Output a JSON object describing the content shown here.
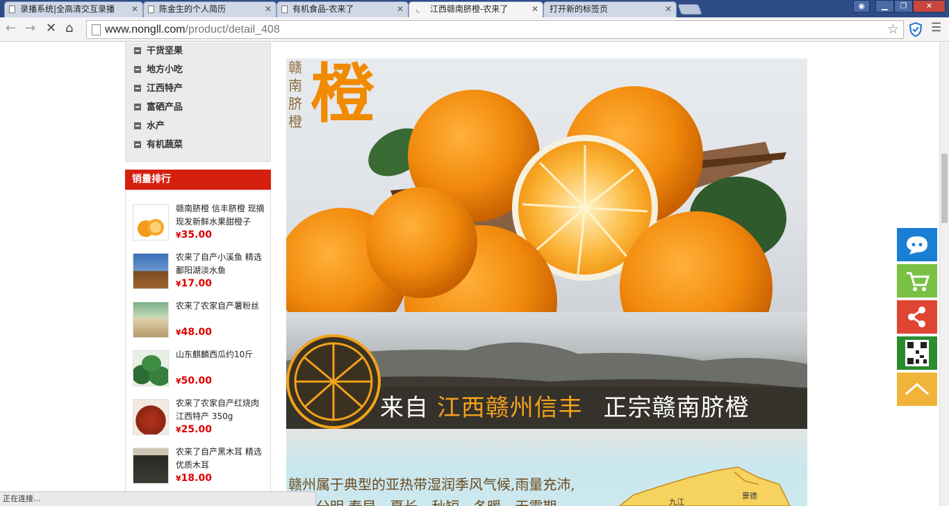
{
  "browser": {
    "tabs": [
      {
        "title": "录播系统|全高清交互录播",
        "active": false
      },
      {
        "title": "陈金生的个人简历",
        "active": false
      },
      {
        "title": "有机食品-农来了",
        "active": false
      },
      {
        "title": "江西赣南脐橙-农来了",
        "active": true
      },
      {
        "title": "打开新的标签页",
        "active": false
      }
    ],
    "url_host": "www.nongll.com",
    "url_path": "/product/detail_408",
    "status_text": "正在连接..."
  },
  "sidebar": {
    "categories": [
      "干货坚果",
      "地方小吃",
      "江西特产",
      "富硒产品",
      "水产",
      "有机蔬菜"
    ],
    "rank_title": "销量排行",
    "rank_items": [
      {
        "name": "赣南脐橙 信丰脐橙 现摘现发新鲜水果甜橙子",
        "price": "35.00",
        "currency": "¥"
      },
      {
        "name": "农来了自产小溪鱼 精选鄱阳湖淡水鱼",
        "price": "17.00",
        "currency": "¥"
      },
      {
        "name": "农来了农家自产薯粉丝",
        "price": "48.00",
        "currency": "¥"
      },
      {
        "name": "山东麒麟西瓜约10斤",
        "price": "50.00",
        "currency": "¥"
      },
      {
        "name": "农来了农家自产红烧肉 江西特产 350g",
        "price": "25.00",
        "currency": "¥"
      },
      {
        "name": "农来了自产黑木耳 精选优质木耳",
        "price": "18.00",
        "currency": "¥"
      }
    ]
  },
  "banner": {
    "logo_vertical": "赣南脐橙",
    "logo_big": "橙",
    "slogan_part1": "来自",
    "slogan_highlight": "江西赣州信丰",
    "slogan_part2": "正宗赣南脐橙",
    "blurb_line1": "赣州属于典型的亚热带湿润季风气候,雨量充沛,",
    "blurb_line2": "四季分明,春早、夏长、秋短、冬暖、无霜期",
    "map_city_1": "九江",
    "map_city_2": "景德"
  },
  "colors": {
    "accent_red": "#d6200f",
    "orange": "#f08a00",
    "blue": "#1a7fd4",
    "green": "#7ac143",
    "share_red": "#e04433",
    "qr_green": "#2b8c2f",
    "top_yellow": "#f0b43b"
  }
}
